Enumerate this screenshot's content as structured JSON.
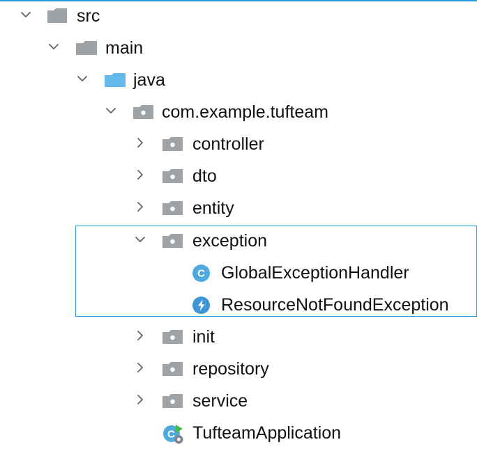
{
  "colors": {
    "accent": "#2f95d7",
    "folder_gray": "#9ea3a8",
    "folder_blue": "#64b8ea",
    "class_icon": "#4ea9dd",
    "exception_icon": "#3d95d4",
    "app_icon_green": "#48b749"
  },
  "project_tree": {
    "items": [
      {
        "label": "src",
        "icon": "folder-icon",
        "expanded": true
      },
      {
        "label": "main",
        "icon": "folder-icon",
        "expanded": true
      },
      {
        "label": "java",
        "icon": "source-folder-icon",
        "expanded": true
      },
      {
        "label": "com.example.tufteam",
        "icon": "package-folder-icon",
        "expanded": true
      },
      {
        "label": "controller",
        "icon": "package-folder-icon",
        "expanded": false
      },
      {
        "label": "dto",
        "icon": "package-folder-icon",
        "expanded": false
      },
      {
        "label": "entity",
        "icon": "package-folder-icon",
        "expanded": false
      },
      {
        "label": "exception",
        "icon": "package-folder-icon",
        "expanded": true
      },
      {
        "label": "GlobalExceptionHandler",
        "icon": "class-icon"
      },
      {
        "label": "ResourceNotFoundException",
        "icon": "exception-class-icon"
      },
      {
        "label": "init",
        "icon": "package-folder-icon",
        "expanded": false
      },
      {
        "label": "repository",
        "icon": "package-folder-icon",
        "expanded": false
      },
      {
        "label": "service",
        "icon": "package-folder-icon",
        "expanded": false
      },
      {
        "label": "TufteamApplication",
        "icon": "spring-application-icon"
      }
    ]
  }
}
